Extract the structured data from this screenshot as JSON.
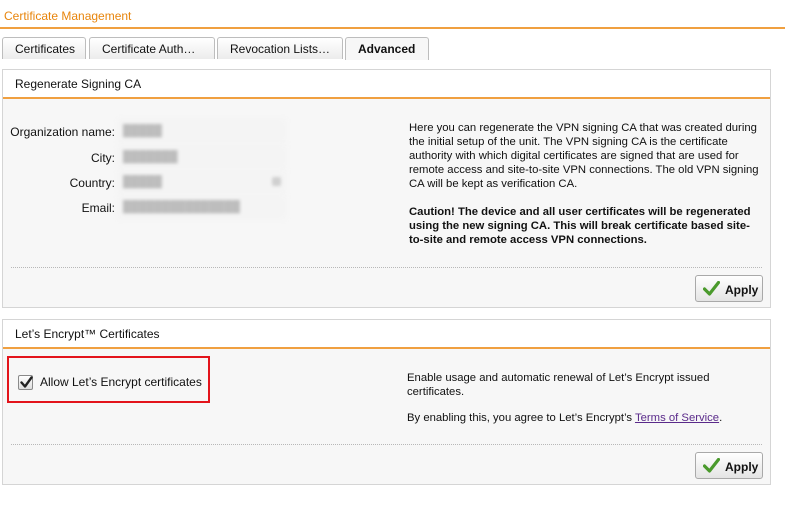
{
  "page": {
    "title": "Certificate Management"
  },
  "tabs": [
    {
      "label": "Certificates"
    },
    {
      "label": "Certificate Auth…"
    },
    {
      "label": "Revocation Lists…"
    },
    {
      "label": "Advanced"
    }
  ],
  "regenerate": {
    "title": "Regenerate Signing CA",
    "fields": {
      "org": {
        "label": "Organization name:",
        "value": "█████"
      },
      "city": {
        "label": "City:",
        "value": "███████"
      },
      "country": {
        "label": "Country:",
        "value": "█████"
      },
      "email": {
        "label": "Email:",
        "value": "███████████████"
      }
    },
    "description": "Here you can regenerate the VPN signing CA that was created during the initial setup of the unit. The VPN signing CA is the certificate authority with which digital certificates are signed that are used for remote access and site-to-site VPN connections. The old VPN signing CA will be kept as verification CA.",
    "caution": "Caution! The device and all user certificates will be regenerated using the new signing CA. This will break certificate based site-to-site and remote access VPN connections.",
    "apply_label": "Apply"
  },
  "letsencrypt": {
    "title": "Let’s Encrypt™ Certificates",
    "checkbox_label": "Allow Let’s Encrypt certificates",
    "checked": true,
    "description": "Enable usage and automatic renewal of Let’s Encrypt issued certificates.",
    "agree_prefix": "By enabling this, you agree to Let’s Encrypt’s ",
    "tos_link": "Terms of Service",
    "agree_suffix": ".",
    "apply_label": "Apply"
  },
  "colors": {
    "accent": "#f0a040",
    "title": "#e8850c",
    "highlight": "#e3141b",
    "check": "#4a9a2c"
  }
}
